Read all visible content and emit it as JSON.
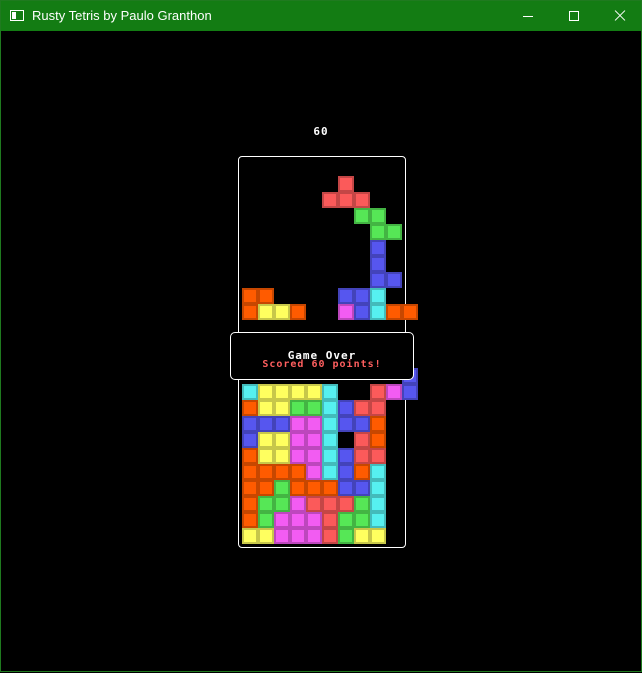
{
  "window": {
    "title": "Rusty Tetris by Paulo Granthon",
    "icon": "app-window-icon",
    "controls": [
      "minimize-icon",
      "maximize-icon",
      "close-icon"
    ],
    "titlebar_color": "#137c13"
  },
  "game": {
    "score": "60",
    "overlay_title": "Game Over",
    "overlay_message": "Scored 60 points!",
    "overlay_message_color": "#ff5f5f"
  },
  "palette": {
    "R": "#fb5a5a",
    "G": "#56e756",
    "B": "#5656ef",
    "C": "#56f0f0",
    "Y": "#ffff5f",
    "O": "#ff5b00",
    "M": "#f25cf2"
  },
  "board": {
    "columns": 10,
    "visible_rows_top": [
      "..........",
      "......R...",
      ".....RRR..",
      ".......GG.",
      "........GG",
      "........B.",
      "........B.",
      "........BB",
      "OO....BBC.",
      "OYYO..MBCOO"
    ],
    "overflow_row": "..........B",
    "visible_rows_bottom": [
      "CYYYYC..RMB",
      "OYYGGCBRR.",
      "BBBMMCBBO.",
      "BYYMMC.RO.",
      "OYYMMCBRR.",
      "OOOOMCBOC.",
      "OOGOOOBBC.",
      "OGGMRRRGC.",
      "OGMMMRGGC.",
      "YYMMMRGYY."
    ]
  }
}
